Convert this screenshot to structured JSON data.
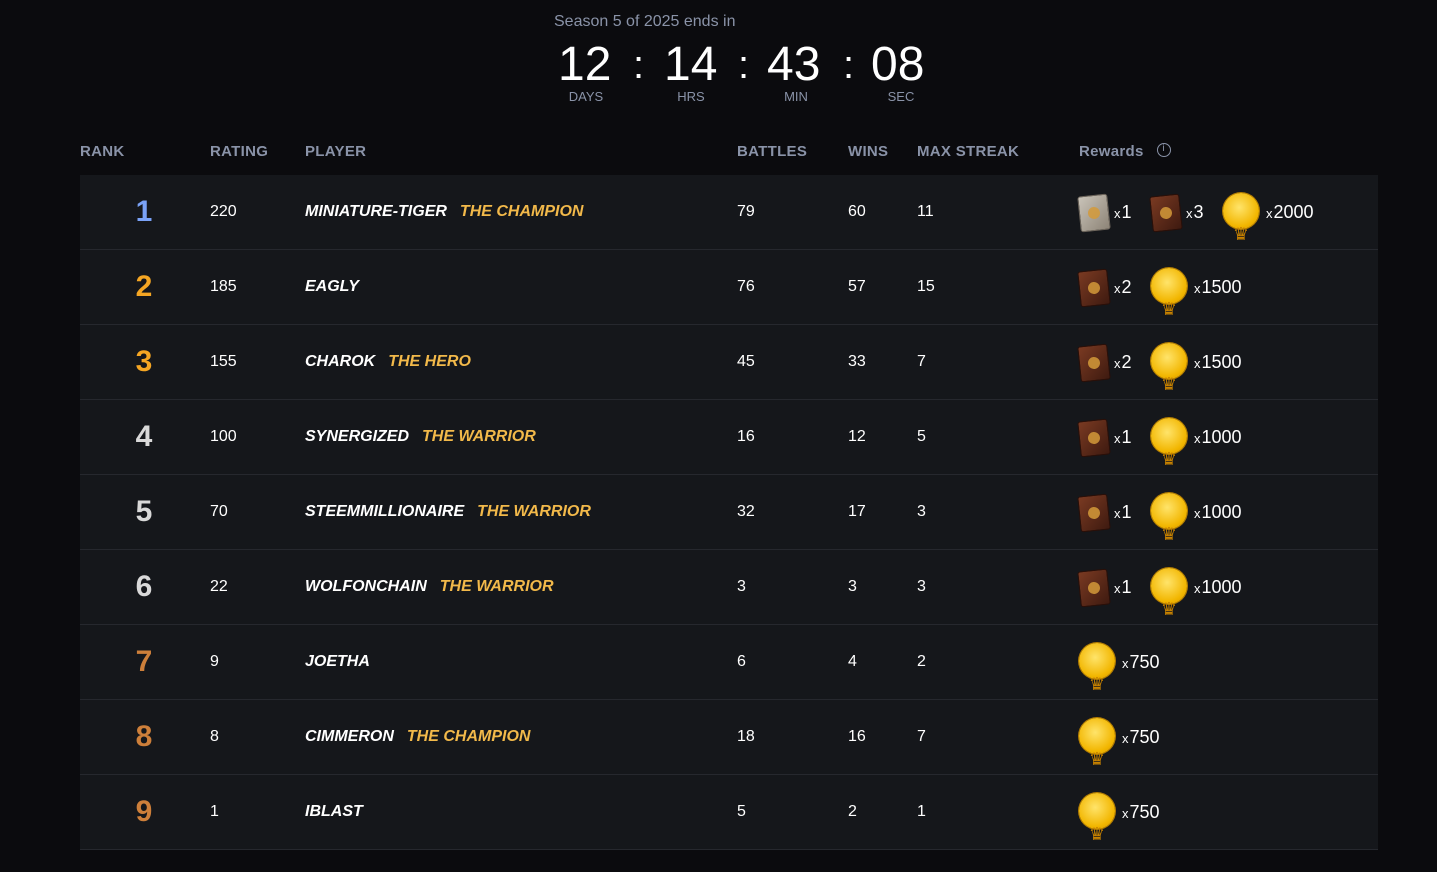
{
  "timer": {
    "caption": "Season 5 of 2025 ends in",
    "separator": ":",
    "units": [
      {
        "value": "12",
        "label": "DAYS"
      },
      {
        "value": "14",
        "label": "HRS"
      },
      {
        "value": "43",
        "label": "MIN"
      },
      {
        "value": "08",
        "label": "SEC"
      }
    ]
  },
  "columns": {
    "rank": "RANK",
    "rating": "RATING",
    "player": "PLAYER",
    "battles": "BATTLES",
    "wins": "WINS",
    "max_streak": "MAX STREAK",
    "rewards": "Rewards"
  },
  "qty_prefix": "x",
  "rows": [
    {
      "rank": "1",
      "rank_color": "#7aa2f7",
      "rating": "220",
      "player": "MINIATURE-TIGER",
      "title": "THE CHAMPION",
      "battles": "79",
      "wins": "60",
      "max_streak": "11",
      "rewards": [
        {
          "icon": "legendary-card-pack-icon",
          "qty": "1"
        },
        {
          "icon": "card-pack-icon",
          "qty": "3"
        },
        {
          "icon": "gold-coin-icon",
          "qty": "2000"
        }
      ]
    },
    {
      "rank": "2",
      "rank_color": "#f5a623",
      "rating": "185",
      "player": "EAGLY",
      "title": "",
      "battles": "76",
      "wins": "57",
      "max_streak": "15",
      "rewards": [
        {
          "icon": "card-pack-icon",
          "qty": "2"
        },
        {
          "icon": "gold-coin-icon",
          "qty": "1500"
        }
      ]
    },
    {
      "rank": "3",
      "rank_color": "#f5a623",
      "rating": "155",
      "player": "CHAROK",
      "title": "THE HERO",
      "battles": "45",
      "wins": "33",
      "max_streak": "7",
      "rewards": [
        {
          "icon": "card-pack-icon",
          "qty": "2"
        },
        {
          "icon": "gold-coin-icon",
          "qty": "1500"
        }
      ]
    },
    {
      "rank": "4",
      "rank_color": "#d9d9d9",
      "rating": "100",
      "player": "SYNERGIZED",
      "title": "THE WARRIOR",
      "battles": "16",
      "wins": "12",
      "max_streak": "5",
      "rewards": [
        {
          "icon": "card-pack-icon",
          "qty": "1"
        },
        {
          "icon": "gold-coin-icon",
          "qty": "1000"
        }
      ]
    },
    {
      "rank": "5",
      "rank_color": "#d9d9d9",
      "rating": "70",
      "player": "STEEMMILLIONAIRE",
      "title": "THE WARRIOR",
      "battles": "32",
      "wins": "17",
      "max_streak": "3",
      "rewards": [
        {
          "icon": "card-pack-icon",
          "qty": "1"
        },
        {
          "icon": "gold-coin-icon",
          "qty": "1000"
        }
      ]
    },
    {
      "rank": "6",
      "rank_color": "#d9d9d9",
      "rating": "22",
      "player": "WOLFONCHAIN",
      "title": "THE WARRIOR",
      "battles": "3",
      "wins": "3",
      "max_streak": "3",
      "rewards": [
        {
          "icon": "card-pack-icon",
          "qty": "1"
        },
        {
          "icon": "gold-coin-icon",
          "qty": "1000"
        }
      ]
    },
    {
      "rank": "7",
      "rank_color": "#cd7f3a",
      "rating": "9",
      "player": "JOETHA",
      "title": "",
      "battles": "6",
      "wins": "4",
      "max_streak": "2",
      "rewards": [
        {
          "icon": "gold-coin-icon",
          "qty": "750"
        }
      ]
    },
    {
      "rank": "8",
      "rank_color": "#cd7f3a",
      "rating": "8",
      "player": "CIMMERON",
      "title": "THE CHAMPION",
      "battles": "18",
      "wins": "16",
      "max_streak": "7",
      "rewards": [
        {
          "icon": "gold-coin-icon",
          "qty": "750"
        }
      ]
    },
    {
      "rank": "9",
      "rank_color": "#cd7f3a",
      "rating": "1",
      "player": "IBLAST",
      "title": "",
      "battles": "5",
      "wins": "2",
      "max_streak": "1",
      "rewards": [
        {
          "icon": "gold-coin-icon",
          "qty": "750"
        }
      ]
    }
  ]
}
